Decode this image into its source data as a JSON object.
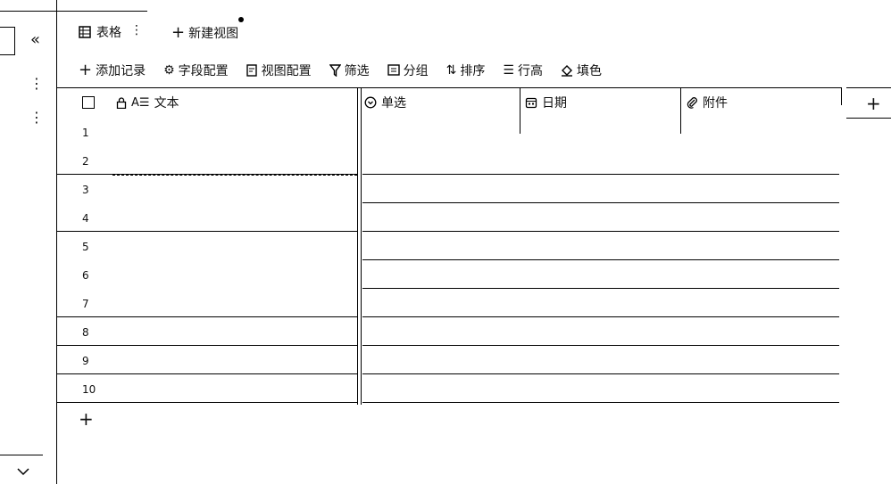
{
  "tabs": {
    "table_label": "表格",
    "new_view_label": "新建视图"
  },
  "toolbar": {
    "add_record": "添加记录",
    "field_config": "字段配置",
    "view_config": "视图配置",
    "filter": "筛选",
    "group": "分组",
    "sort": "排序",
    "row_height": "行高",
    "fill_color": "填色"
  },
  "columns": [
    {
      "label": "文本",
      "icon": "text-field-icon",
      "locked": true
    },
    {
      "label": "单选",
      "icon": "single-select-icon"
    },
    {
      "label": "日期",
      "icon": "calendar-icon"
    },
    {
      "label": "附件",
      "icon": "paperclip-icon"
    }
  ],
  "rows": [
    "1",
    "2",
    "3",
    "4",
    "5",
    "6",
    "7",
    "8",
    "9",
    "10"
  ]
}
